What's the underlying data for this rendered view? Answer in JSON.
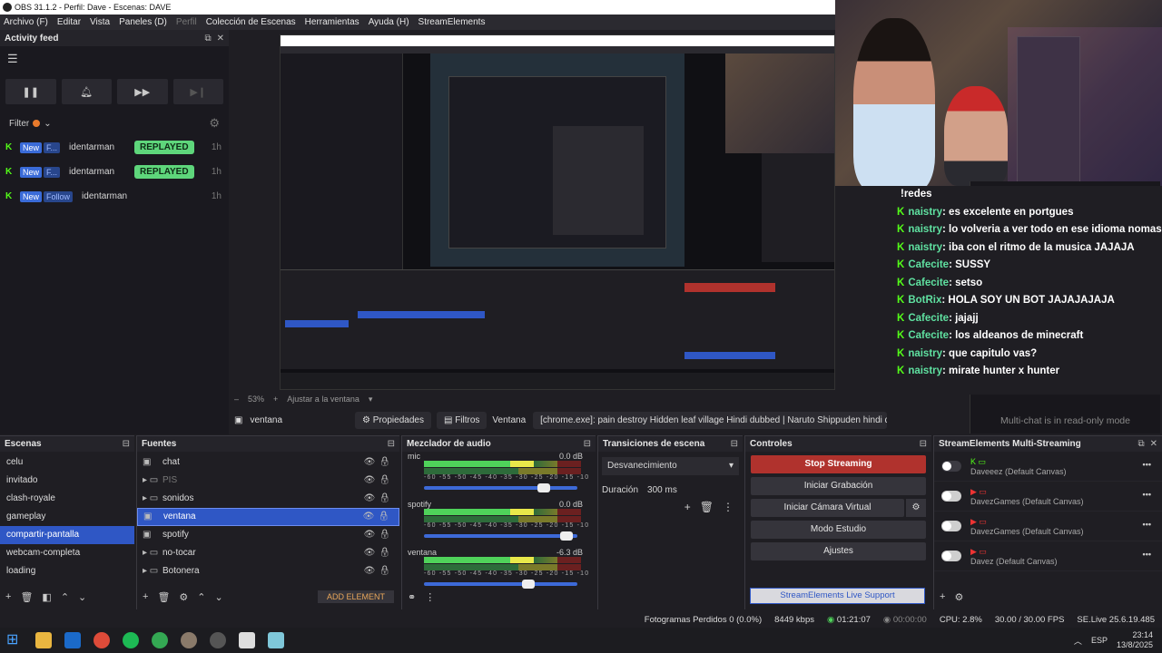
{
  "window": {
    "title": "OBS 31.1.2 - Perfil: Dave - Escenas: DAVE"
  },
  "menu": [
    "Archivo (F)",
    "Editar",
    "Vista",
    "Paneles (D)",
    "Perfil",
    "Colección de Escenas",
    "Herramientas",
    "Ayuda (H)",
    "StreamElements"
  ],
  "activity_feed": {
    "title": "Activity feed",
    "filter_label": "Filter",
    "items": [
      {
        "tag": "New",
        "type": "F...",
        "user": "identarman",
        "badge": "REPLAYED",
        "ago": "1h"
      },
      {
        "tag": "New",
        "type": "F...",
        "user": "identarman",
        "badge": "REPLAYED",
        "ago": "1h"
      },
      {
        "tag": "New",
        "type": "Follow",
        "user": "identarman",
        "badge": "",
        "ago": "1h"
      }
    ]
  },
  "chat_overlay": [
    {
      "user": "",
      "msg": "!redes"
    },
    {
      "user": "naistry",
      "msg": ": es excelente en portgues"
    },
    {
      "user": "naistry",
      "msg": ": lo volveria a ver todo en ese idioma nomas"
    },
    {
      "user": "naistry",
      "msg": ": iba con el ritmo de la musica JAJAJA"
    },
    {
      "user": "Cafecite",
      "msg": ": SUSSY"
    },
    {
      "user": "Cafecite",
      "msg": ": setso"
    },
    {
      "user": "BotRix",
      "msg": ": HOLA SOY UN BOT JAJAJAJAJA"
    },
    {
      "user": "Cafecite",
      "msg": ": jajajj"
    },
    {
      "user": "Cafecite",
      "msg": ": los aldeanos de minecraft"
    },
    {
      "user": "naistry",
      "msg": ": que capitulo vas?"
    },
    {
      "user": "naistry",
      "msg": ": mirate hunter x hunter"
    }
  ],
  "bg_chat": {
    "lines": [
      "naistry: lo volveria a ver todo en ese",
      "Cafecite: SUSSY",
      "Cafecite: setso",
      "JAJAJAJA",
      "Cafecite: los aldeanos de minecraft",
      "naistry: que capitulo vas?",
      "naistry: mirate hunter x hunter"
    ],
    "readonly": "Multi-chat is in read-only mode"
  },
  "preview_bar": {
    "zoom": "53%",
    "fit": "Ajustar a la ventana"
  },
  "source_bar": {
    "name": "ventana",
    "props": "Propiedades",
    "filters": "Filtros",
    "window_label": "Ventana",
    "window_value": "[chrome.exe]: pain destroy Hidden leaf village Hindi dubbed | Naruto Shippuden hindi dubbec"
  },
  "scenes": {
    "title": "Escenas",
    "items": [
      "celu",
      "invitado",
      "clash-royale",
      "gameplay",
      "compartir-pantalla",
      "webcam-completa",
      "loading"
    ],
    "selected": 4
  },
  "sources": {
    "title": "Fuentes",
    "items": [
      {
        "name": "chat",
        "indent": 0
      },
      {
        "name": "PIS",
        "indent": 1,
        "dim": true
      },
      {
        "name": "sonidos",
        "indent": 1
      },
      {
        "name": "ventana",
        "indent": 0,
        "selected": true
      },
      {
        "name": "spotify",
        "indent": 0
      },
      {
        "name": "no-tocar",
        "indent": 1
      },
      {
        "name": "Botonera",
        "indent": 1
      }
    ],
    "add": "ADD ELEMENT"
  },
  "mixer": {
    "title": "Mezclador de audio",
    "channels": [
      {
        "name": "mic",
        "db": "0.0 dB",
        "level": 0.8
      },
      {
        "name": "spotify",
        "db": "0.0 dB",
        "level": 0.95
      },
      {
        "name": "ventana",
        "db": "-6.3 dB",
        "level": 0.7
      }
    ],
    "ticks": "-60 -55 -50 -45 -40 -35 -30 -25 -20 -15 -10 -5 0"
  },
  "transitions": {
    "title": "Transiciones de escena",
    "type": "Desvanecimiento",
    "duration_label": "Duración",
    "duration": "300 ms"
  },
  "controls": {
    "title": "Controles",
    "stop": "Stop Streaming",
    "record": "Iniciar Grabación",
    "vcam": "Iniciar Cámara Virtual",
    "studio": "Modo Estudio",
    "settings": "Ajustes"
  },
  "se_multi": {
    "title": "StreamElements Multi-Streaming",
    "rows": [
      "Daveeez (Default Canvas)",
      "DavezGames (Default Canvas)",
      "DavezGames (Default Canvas)",
      "Davez (Default Canvas)"
    ],
    "support": "StreamElements Live Support"
  },
  "status": {
    "dropped": "Fotogramas Perdidos 0 (0.0%)",
    "kbps": "8449 kbps",
    "live": "01:21:07",
    "rec": "00:00:00",
    "cpu": "CPU: 2.8%",
    "fps": "30.00 / 30.00 FPS",
    "version": "SE.Live 25.6.19.485"
  },
  "taskbar": {
    "lang": "ESP",
    "time": "23:14",
    "date": "13/8/2025"
  },
  "colors": {
    "accent": "#2f57c5",
    "kick": "#53fc18",
    "stop": "#b0322d",
    "replayed": "#5ed67b"
  }
}
